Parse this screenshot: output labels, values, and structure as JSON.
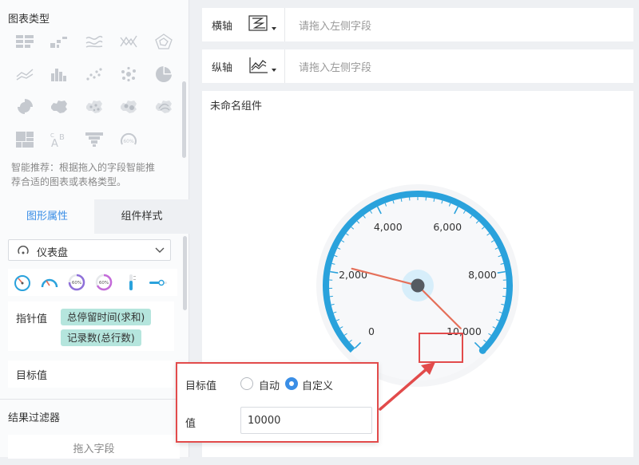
{
  "left": {
    "chart_type_title": "图表类型",
    "chart_types": [
      "table-icon",
      "grouped-bar-icon",
      "wave-line-icon",
      "area-cross-icon",
      "radar-icon",
      "multi-line-icon",
      "bar-chart-icon",
      "scatter-icon",
      "bubble-icon",
      "pie-icon",
      "rose-icon",
      "china-map-icon",
      "scatter-map-icon",
      "heat-map-icon",
      "flow-map-icon",
      "treemap-icon",
      "word-cloud-icon",
      "funnel-icon",
      "gauge-percent-icon"
    ],
    "recommend_text_line1": "智能推荐：根据拖入的字段智能推",
    "recommend_text_line2": "荐合适的图表或表格类型。",
    "tabs": [
      {
        "label": "图形属性",
        "active": true
      },
      {
        "label": "组件样式",
        "active": false
      }
    ],
    "gauge_select": {
      "value": "仪表盘"
    },
    "gauge_variants": [
      "gauge-classic-icon",
      "gauge-half-icon",
      "ring-percent-icon",
      "ring-percent-alt-icon",
      "thermometer-icon",
      "slider-icon"
    ],
    "gauge_variant_percent_text": "60%",
    "pointer_label": "指针值",
    "pointer_fields": [
      "总停留时间(求和)",
      "记录数(总行数)"
    ],
    "target_label": "目标值",
    "filter_title": "结果过滤器",
    "drop_text": "拖入字段"
  },
  "axes": {
    "x": {
      "label": "横轴",
      "placeholder": "请拖入左侧字段"
    },
    "y": {
      "label": "纵轴",
      "placeholder": "请拖入左侧字段"
    }
  },
  "widget": {
    "title": "未命名组件"
  },
  "gauge": {
    "min": 0,
    "max": 10000,
    "pointer_value": 2200,
    "target_value": 10000,
    "ticks": [
      "0",
      "2,000",
      "4,000",
      "6,000",
      "8,000",
      "10,000"
    ],
    "arc_color": "#2aa2dc",
    "needle_color": "#e5705a"
  },
  "popup": {
    "target_label": "目标值",
    "options": [
      {
        "label": "自动",
        "checked": false
      },
      {
        "label": "自定义",
        "checked": true
      }
    ],
    "value_label": "值",
    "value": "10000"
  },
  "colors": {
    "accent": "#3a8ee6",
    "highlight": "#e24b4b",
    "pill": "#b5e5dd"
  }
}
